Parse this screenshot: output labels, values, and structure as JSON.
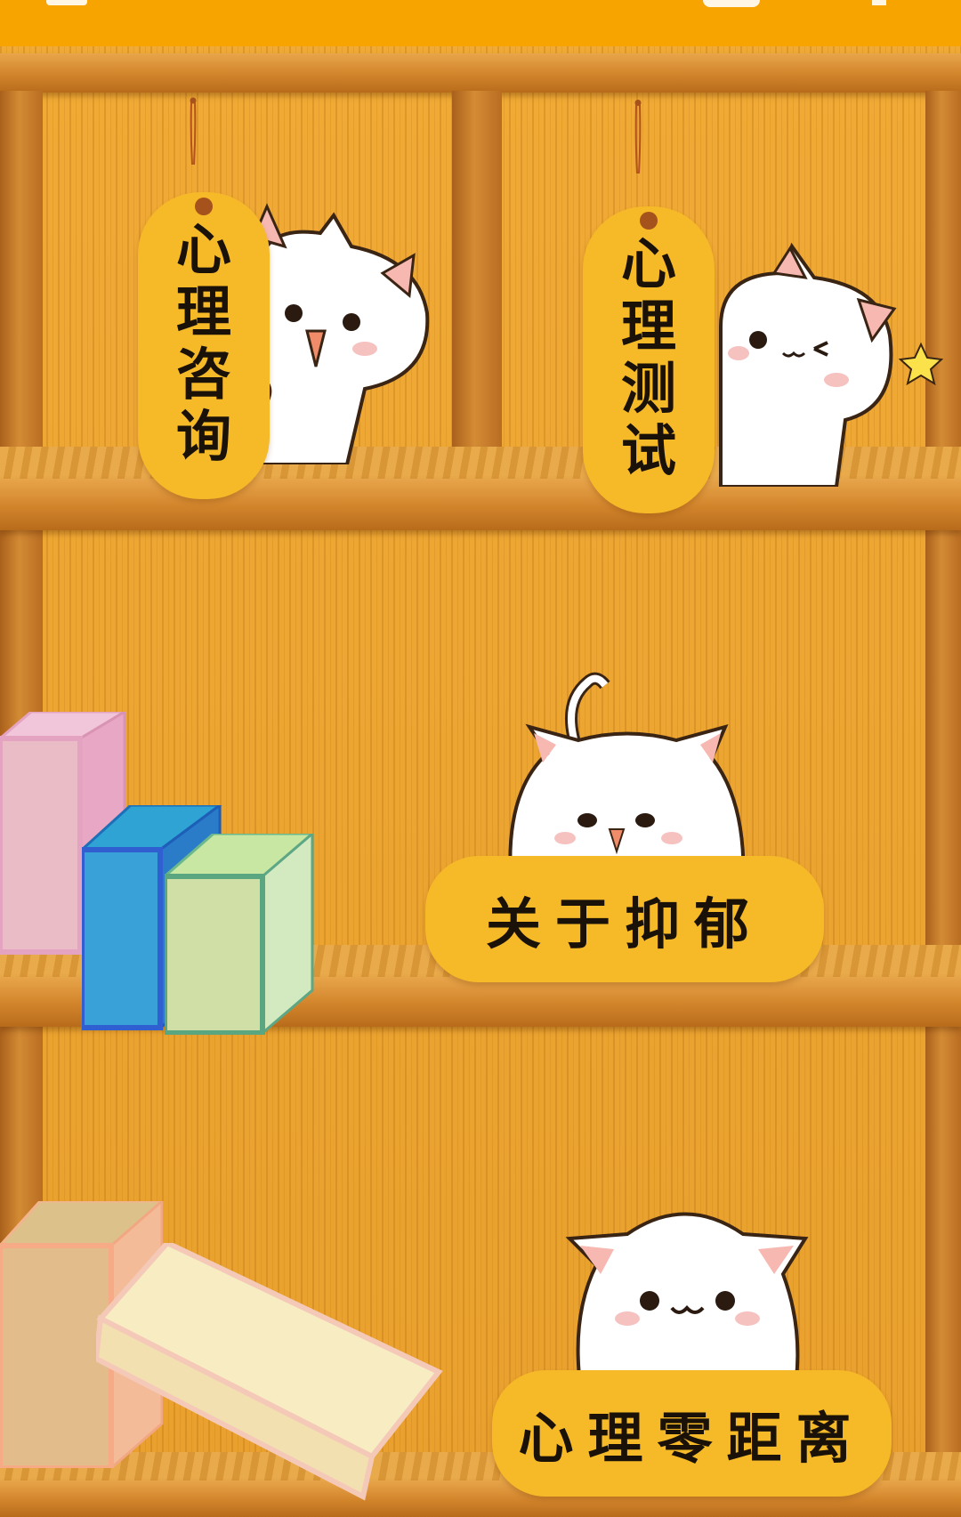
{
  "app": {
    "status_bar_color": "#f8a400",
    "background_color": "#e9a02d"
  },
  "menu": {
    "counseling": {
      "label": "心理咨询",
      "icon": "cat-peeking-icon"
    },
    "test": {
      "label": "心理测试",
      "icon": "cat-winking-icon"
    },
    "about_depression": {
      "label": "关于抑郁",
      "icon": "cat-lying-icon"
    },
    "zero_distance": {
      "label": "心理零距离",
      "icon": "cat-smiling-icon"
    }
  },
  "decor": {
    "books_middle": [
      "pink-book",
      "blue-book",
      "green-book"
    ],
    "books_bottom": [
      "beige-book",
      "cream-book"
    ]
  },
  "colors": {
    "tag": "#f6b928",
    "tag_text": "#1a1208",
    "shelf": "#d2842b"
  }
}
